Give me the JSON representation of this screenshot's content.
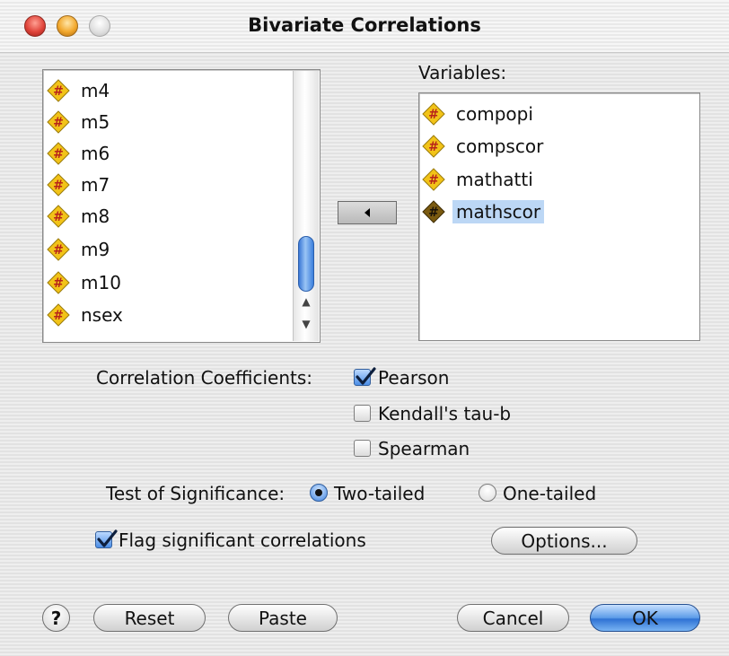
{
  "window": {
    "title": "Bivariate Correlations"
  },
  "source_list": {
    "items": [
      {
        "label": "m4"
      },
      {
        "label": "m5"
      },
      {
        "label": "m6"
      },
      {
        "label": "m7"
      },
      {
        "label": "m8"
      },
      {
        "label": "m9"
      },
      {
        "label": "m10"
      },
      {
        "label": "nsex"
      }
    ]
  },
  "target_list": {
    "label": "Variables:",
    "items": [
      {
        "label": "compopi",
        "selected": false
      },
      {
        "label": "compscor",
        "selected": false
      },
      {
        "label": "mathatti",
        "selected": false
      },
      {
        "label": "mathscor",
        "selected": true
      }
    ]
  },
  "move_button": {
    "icon": "left-triangle-arrow-icon"
  },
  "correlation": {
    "label": "Correlation Coefficients:",
    "options": [
      {
        "label": "Pearson",
        "checked": true
      },
      {
        "label": "Kendall's tau-b",
        "checked": false
      },
      {
        "label": "Spearman",
        "checked": false
      }
    ]
  },
  "significance": {
    "label": "Test of Significance:",
    "options": [
      {
        "label": "Two-tailed",
        "selected": true
      },
      {
        "label": "One-tailed",
        "selected": false
      }
    ]
  },
  "flag": {
    "label": "Flag significant correlations",
    "checked": true
  },
  "buttons": {
    "options": "Options...",
    "help": "?",
    "reset": "Reset",
    "paste": "Paste",
    "cancel": "Cancel",
    "ok": "OK"
  },
  "colors": {
    "variable_icon": "#f2c318",
    "variable_icon_selected": "#7a5a10",
    "selection": "#bcd7f5",
    "default_button": "#3b7fdc"
  }
}
